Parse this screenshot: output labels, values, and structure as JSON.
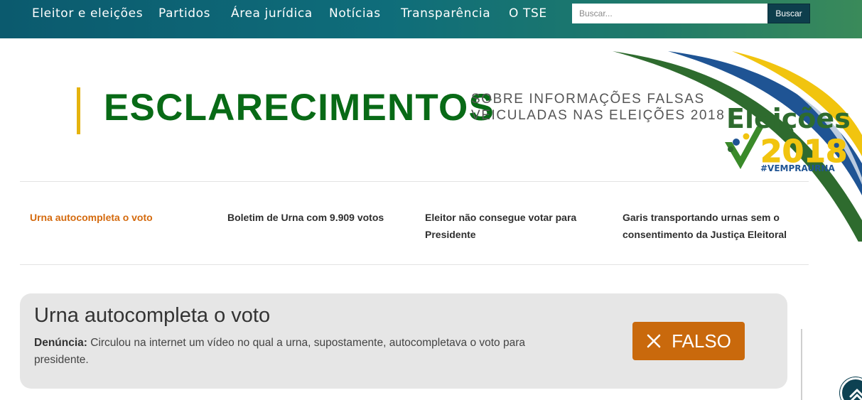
{
  "nav": {
    "items": [
      {
        "label": "Eleitor e eleições"
      },
      {
        "label": "Partidos"
      },
      {
        "label": "Área jurídica"
      },
      {
        "label": "Notícias"
      },
      {
        "label": "Transparência"
      },
      {
        "label": "O TSE"
      }
    ],
    "search_placeholder": "Buscar...",
    "search_button": "Buscar"
  },
  "header": {
    "title": "ESCLARECIMENTOS",
    "subtitle": "SOBRE INFORMAÇÕES FALSAS VEICULADAS NAS ELEIÇÕES 2018"
  },
  "logo": {
    "word": "Eleições",
    "year": "2018",
    "hashtag": "#VEMPRAURNA"
  },
  "tabs": [
    {
      "label": "Urna autocompleta o voto",
      "active": true
    },
    {
      "label": "Boletim de Urna com 9.909 votos",
      "active": false
    },
    {
      "label": "Eleitor não consegue votar para Presidente",
      "active": false
    },
    {
      "label": "Garis transportando urnas sem o consentimento da Justiça Eleitoral",
      "active": false
    }
  ],
  "card": {
    "title": "Urna autocompleta o voto",
    "denuncia_label": "Denúncia:",
    "denuncia_text": " Circulou na internet um vídeo no qual a urna, supostamente, autocompletava o voto para presidente.",
    "verdict": "FALSO",
    "verdict_icon": "close-icon"
  },
  "colors": {
    "nav_bg": "#0f6d7a",
    "title_green": "#086a16",
    "accent_yellow": "#e5b30e",
    "active_orange": "#d46a0e",
    "verdict_bg": "#c9690c",
    "card_bg": "#e6e6e6"
  },
  "icons": {
    "scroll_top": "chevron-up-icon"
  }
}
